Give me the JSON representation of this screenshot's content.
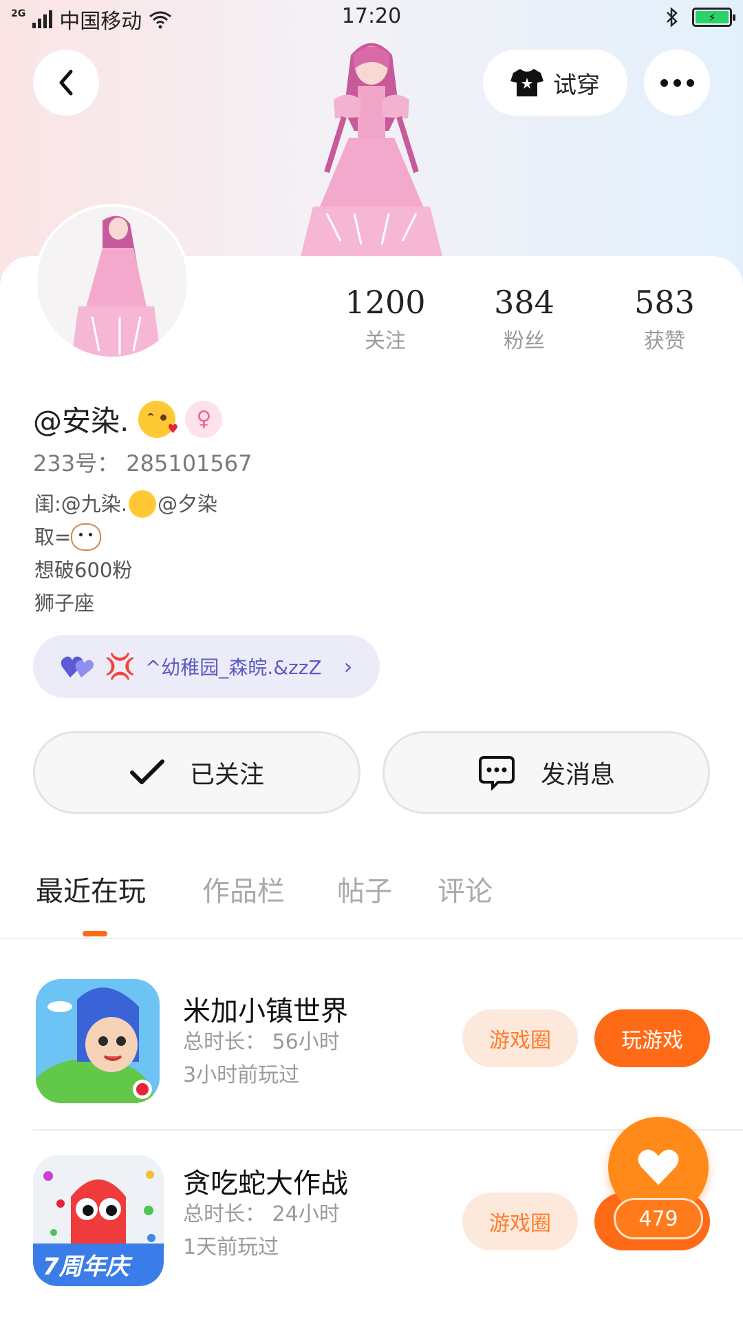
{
  "status_bar": {
    "network": "2G",
    "carrier": "中国移动",
    "time": "17:20"
  },
  "header": {
    "tryon_label": "试穿"
  },
  "stats": [
    {
      "value": "1200",
      "label": "关注"
    },
    {
      "value": "384",
      "label": "粉丝"
    },
    {
      "value": "583",
      "label": "获赞"
    }
  ],
  "profile": {
    "name": "@安染.",
    "id_line": "233号： 285101567",
    "bio_line1_a": "闺:@九染.",
    "bio_line1_b": "@夕染",
    "bio_line2": "取=",
    "bio_line3": "想破600粉",
    "bio_line4": "狮子座",
    "gender_symbol": "♀"
  },
  "cp": {
    "label": "^幼稚园_森皖.&zzZ"
  },
  "actions": {
    "follow_label": "已关注",
    "message_label": "发消息"
  },
  "tabs": [
    "最近在玩",
    "作品栏",
    "帖子",
    "评论"
  ],
  "games": [
    {
      "title": "米加小镇世界",
      "duration": "总时长： 56小时",
      "last_played": "3小时前玩过",
      "circle_label": "游戏圈",
      "play_label": "玩游戏"
    },
    {
      "title": "贪吃蛇大作战",
      "duration": "总时长： 24小时",
      "last_played": "1天前玩过",
      "circle_label": "游戏圈",
      "badge_text": "7周年庆"
    }
  ],
  "fab": {
    "count": "479"
  },
  "colors": {
    "accent": "#ff6a17",
    "cp_pill": "#ececf9",
    "cp_text": "#5b5bc4"
  }
}
